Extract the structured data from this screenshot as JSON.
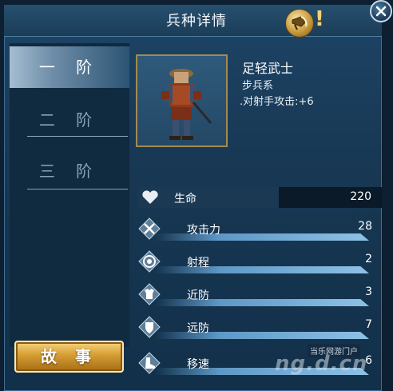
{
  "header": {
    "title": "兵种详情",
    "help_mark": "!"
  },
  "tabs": [
    {
      "label": "一 阶",
      "active": true
    },
    {
      "label": "二 阶",
      "active": false
    },
    {
      "label": "三 阶",
      "active": false
    }
  ],
  "story_button": {
    "label": "故 事"
  },
  "unit": {
    "name": "足轻武士",
    "type": "步兵系",
    "bonus": ".对射手攻击:+6"
  },
  "stats": {
    "hp": {
      "label": "生命",
      "value": "220",
      "icon": "heart-icon"
    },
    "list": [
      {
        "label": "攻击力",
        "value": "28",
        "icon": "crossed-swords-icon"
      },
      {
        "label": "射程",
        "value": "2",
        "icon": "target-icon"
      },
      {
        "label": "近防",
        "value": "3",
        "icon": "armor-icon"
      },
      {
        "label": "远防",
        "value": "7",
        "icon": "shield-icon"
      },
      {
        "label": "移速",
        "value": "6",
        "icon": "boot-icon"
      }
    ]
  },
  "watermark": {
    "text": "当乐网游门户",
    "logo": "ng.d.cn"
  },
  "colors": {
    "accent_gold": "#d59d33",
    "panel_blue": "#173752",
    "stat_bar": "#8ec1e6"
  }
}
